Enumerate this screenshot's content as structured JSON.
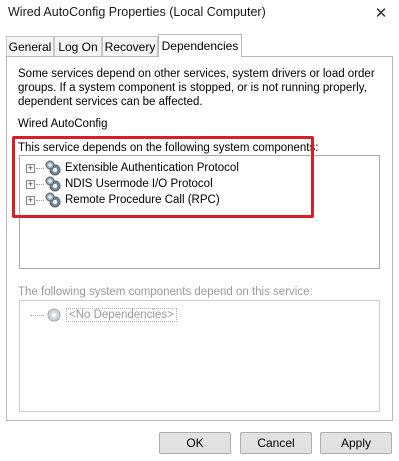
{
  "window": {
    "title": "Wired AutoConfig Properties (Local Computer)",
    "close_glyph": "✕"
  },
  "tabs": [
    {
      "label": "General"
    },
    {
      "label": "Log On"
    },
    {
      "label": "Recovery"
    },
    {
      "label": "Dependencies",
      "active": true
    }
  ],
  "dependencies": {
    "description": "Some services depend on other services, system drivers or load order groups. If a system component is stopped, or is not running properly, dependent services can be affected.",
    "service_name": "Wired AutoConfig",
    "depends_on_label": "This service depends on the following system components:",
    "depends_on": [
      {
        "label": "Extensible Authentication Protocol",
        "expander": "+",
        "icon": "gear-service-icon"
      },
      {
        "label": "NDIS Usermode I/O Protocol",
        "expander": "+",
        "icon": "gear-service-icon"
      },
      {
        "label": "Remote Procedure Call (RPC)",
        "expander": "+",
        "icon": "gear-service-icon"
      }
    ],
    "dependents_label": "The following system components depend on this service:",
    "dependents": [
      {
        "label": "<No Dependencies>",
        "icon": "gear-service-icon"
      }
    ]
  },
  "buttons": {
    "ok": "OK",
    "cancel": "Cancel",
    "apply": "Apply"
  },
  "annotation": {
    "highlight_color": "#d42027"
  }
}
